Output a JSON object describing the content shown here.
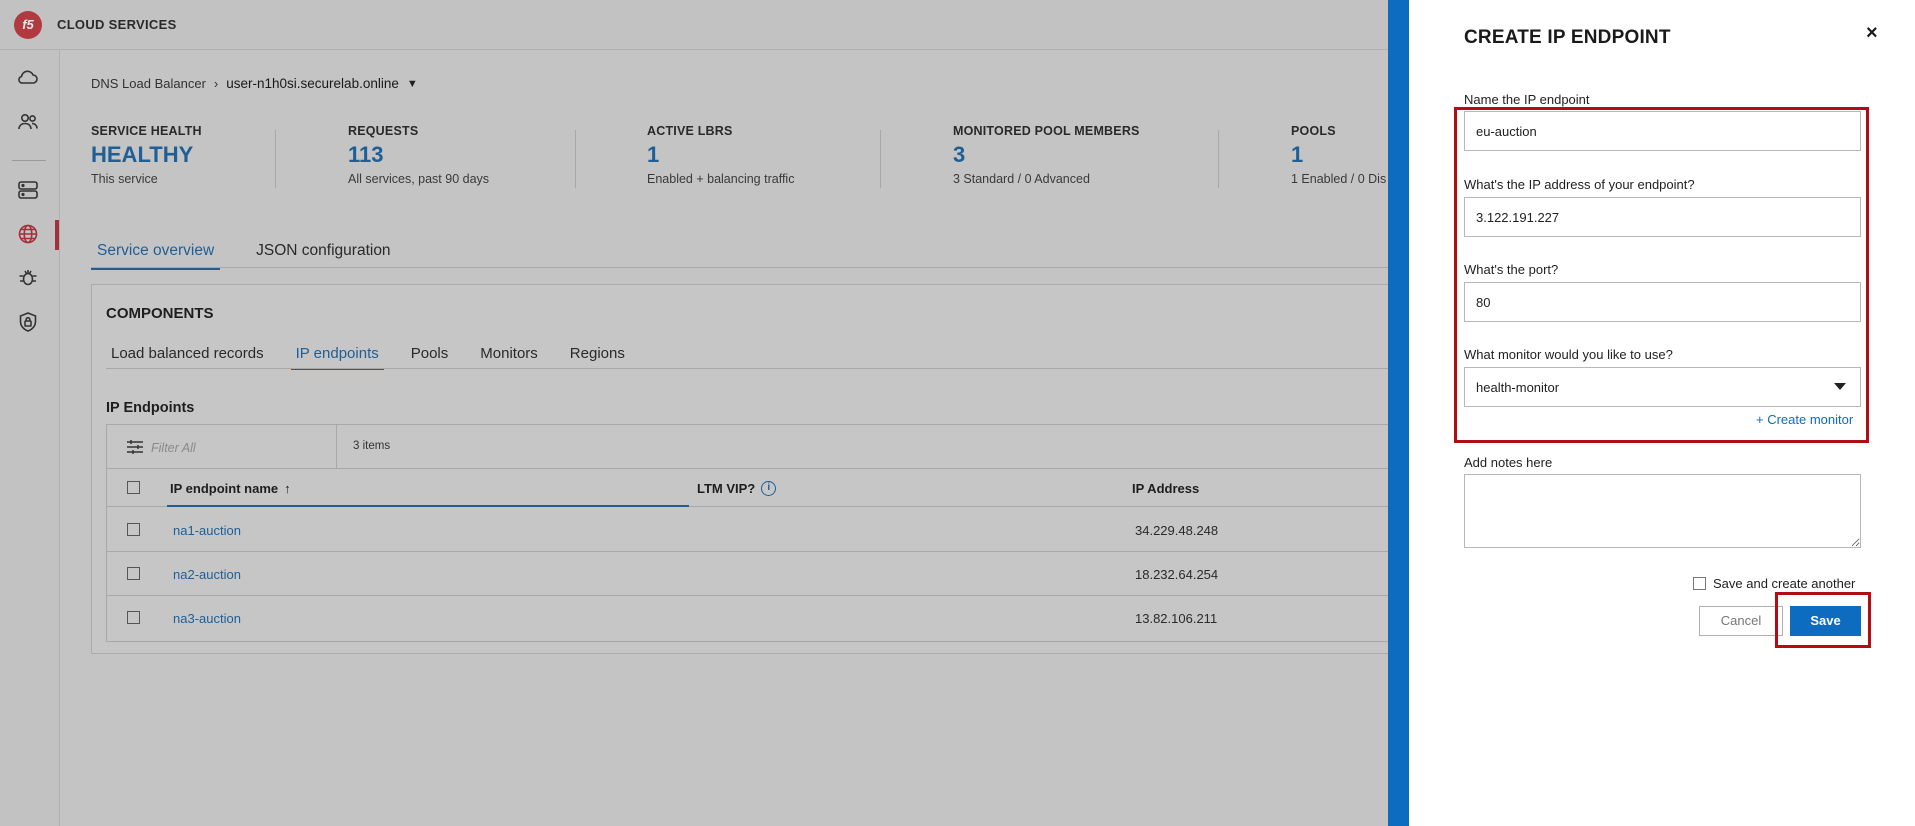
{
  "app": {
    "title": "CLOUD SERVICES",
    "logo_text": "f5"
  },
  "sidenav": {
    "items": [
      {
        "icon": "cloud-icon"
      },
      {
        "icon": "users-icon"
      },
      {
        "icon": "server-icon"
      },
      {
        "icon": "globe-icon",
        "active": true
      },
      {
        "icon": "bug-icon"
      },
      {
        "icon": "shield-lock-icon"
      }
    ]
  },
  "breadcrumb": {
    "parent": "DNS Load Balancer",
    "current": "user-n1h0si.securelab.online"
  },
  "stats": [
    {
      "label": "SERVICE HEALTH",
      "value": "HEALTHY",
      "sub": "This service"
    },
    {
      "label": "REQUESTS",
      "value": "113",
      "sub": "All services, past 90 days"
    },
    {
      "label": "ACTIVE LBRS",
      "value": "1",
      "sub": "Enabled + balancing traffic"
    },
    {
      "label": "MONITORED POOL MEMBERS",
      "value": "3",
      "sub": "3 Standard / 0 Advanced"
    },
    {
      "label": "POOLS",
      "value": "1",
      "sub": "1 Enabled / 0 Dis"
    }
  ],
  "main_tabs": [
    {
      "label": "Service overview",
      "active": true
    },
    {
      "label": "JSON configuration",
      "active": false
    }
  ],
  "components": {
    "title": "COMPONENTS",
    "tabs": [
      {
        "label": "Load balanced records",
        "active": false
      },
      {
        "label": "IP endpoints",
        "active": true
      },
      {
        "label": "Pools",
        "active": false
      },
      {
        "label": "Monitors",
        "active": false
      },
      {
        "label": "Regions",
        "active": false
      }
    ],
    "section_title": "IP Endpoints",
    "filter_placeholder": "Filter All",
    "item_count": "3 items",
    "columns": {
      "name": "IP endpoint name",
      "sort": "↑",
      "ltm": "LTM VIP?",
      "ip": "IP Address"
    },
    "rows": [
      {
        "name": "na1-auction",
        "ip": "34.229.48.248"
      },
      {
        "name": "na2-auction",
        "ip": "18.232.64.254"
      },
      {
        "name": "na3-auction",
        "ip": "13.82.106.211"
      }
    ]
  },
  "panel": {
    "title": "CREATE IP ENDPOINT",
    "close": "×",
    "name_label": "Name the IP endpoint",
    "name_value": "eu-auction",
    "ip_label": "What's the IP address of your endpoint?",
    "ip_value": "3.122.191.227",
    "port_label": "What's the port?",
    "port_value": "80",
    "monitor_label": "What monitor would you like to use?",
    "monitor_value": "health-monitor",
    "create_monitor": "+ Create monitor",
    "notes_label": "Add notes here",
    "notes_value": "",
    "save_another_label": "Save and create another",
    "cancel_label": "Cancel",
    "save_label": "Save"
  },
  "colors": {
    "accent": "#0d6cbf",
    "highlight": "#b30d14",
    "brand": "#a3303a"
  }
}
